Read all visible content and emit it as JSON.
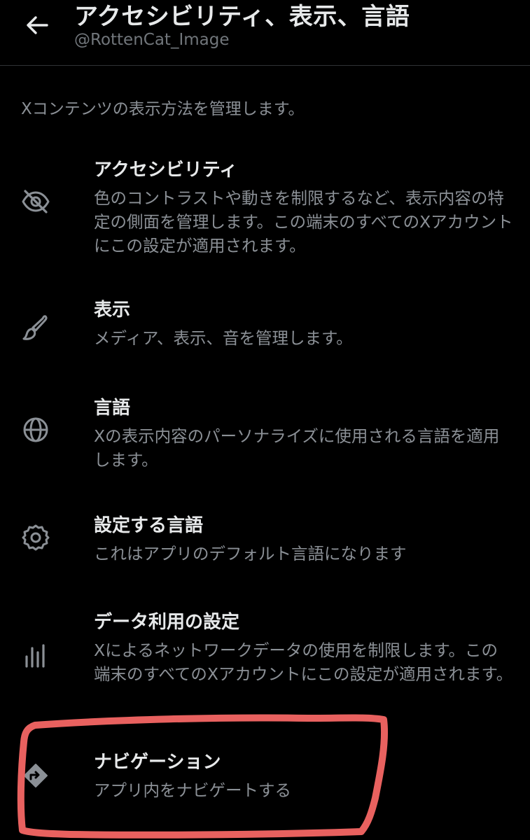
{
  "header": {
    "title": "アクセシビリティ、表示、言語",
    "handle": "@RottenCat_Image",
    "back_icon": "arrow-left-icon"
  },
  "intro": "Xコンテンツの表示方法を管理します。",
  "items": [
    {
      "title": "アクセシビリティ",
      "description": "色のコントラストや動きを制限するなど、表示内容の特定の側面を管理します。この端末のすべてのXアカウントにこの設定が適用されます。",
      "icon": "eye-off-icon"
    },
    {
      "title": "表示",
      "description": "メディア、表示、音を管理します。",
      "icon": "paintbrush-icon"
    },
    {
      "title": "言語",
      "description": "Xの表示内容のパーソナライズに使用される言語を適用します。",
      "icon": "globe-icon"
    },
    {
      "title": "設定する言語",
      "description": "これはアプリのデフォルト言語になります",
      "icon": "gear-icon"
    },
    {
      "title": "データ利用の設定",
      "description": "Xによるネットワークデータの使用を制限します。この端末のすべてのXアカウントにこの設定が適用されます。",
      "icon": "bar-chart-icon"
    },
    {
      "title": "ナビゲーション",
      "description": "アプリ内をナビゲートする",
      "icon": "directions-icon"
    }
  ],
  "colors": {
    "background": "#000000",
    "primary_text": "#e7e9ea",
    "secondary_text": "#8b9096",
    "icon": "#8b9096",
    "highlight_annotation": "#e8615f"
  }
}
